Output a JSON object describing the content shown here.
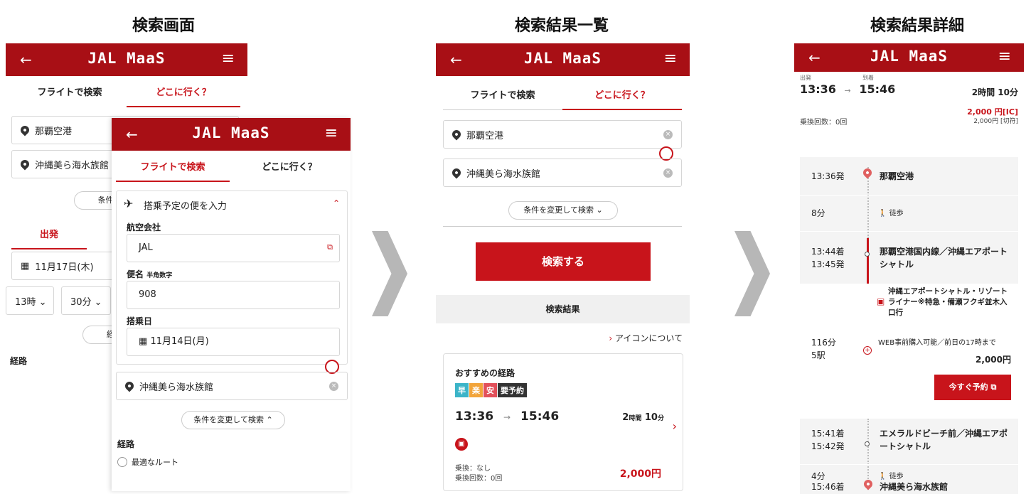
{
  "captions": [
    "検索画面",
    "検索結果一覧",
    "検索結果詳細"
  ],
  "header": {
    "back": "←",
    "logo": "JAL MaaS",
    "menu": "≡"
  },
  "screen1": {
    "tab_flight": "フライトで検索",
    "tab_where": "どこに行く？",
    "from": "那覇空港",
    "to": "沖縄美ら海水族館",
    "cond_btn": "条件を",
    "depart_tab": "出発",
    "date": "11月17日(木)",
    "hour": "13時 ⌄",
    "minute": "30分 ⌄",
    "route_btn": "経路",
    "route_label": "経路"
  },
  "screen1b": {
    "tab_flight": "フライトで検索",
    "tab_where": "どこに行く？",
    "flight_input": "搭乗予定の便を入力",
    "airline_label": "航空会社",
    "airline": "JAL",
    "flight_no_label": "便名",
    "flight_no_hint": "半角数字",
    "flight_no": "908",
    "board_label": "搭乗日",
    "board_date": "11月14日(月)",
    "dest": "沖縄美ら海水族館",
    "cond_btn": "条件を変更して検索 ⌃",
    "route_label": "経路",
    "route_opt": "最適なルート"
  },
  "screen2": {
    "tab_flight": "フライトで検索",
    "tab_where": "どこに行く？",
    "from": "那覇空港",
    "to": "沖縄美ら海水族館",
    "cond_btn": "条件を変更して検索 ⌄",
    "search_btn": "検索する",
    "results_hdr": "検索結果",
    "icon_about": "アイコンについて",
    "rec_title": "おすすめの経路",
    "tags": [
      "早",
      "楽",
      "安",
      "要予約"
    ],
    "dep": "13:36",
    "arr": "15:46",
    "dur_h": "2",
    "dur_h_unit": "時間",
    "dur_m": "10",
    "dur_m_unit": "分",
    "transfer": "乗換：なし",
    "transfer_count": "乗換回数：0回",
    "price": "2,000円"
  },
  "screen3": {
    "dep_label": "出発",
    "arr_label": "到着",
    "dep": "13:36",
    "arr": "15:46",
    "dur": "2時間 10分",
    "price_ic": "2,000 円[IC]",
    "price_ticket": "2,000円 [切符]",
    "transfers": "乗換回数：0回",
    "s1_time": "13:36発",
    "s1_name": "那覇空港",
    "walk1": "8分",
    "walk_label": "徒歩",
    "s2_arr": "13:44着",
    "s2_dep": "13:45発",
    "s2_name": "那覇空港国内線／沖縄エアポートシャトル",
    "bus_name": "沖縄エアポートシャトル・リゾートライナー※特急・備瀬フクギ並木入口行",
    "ride_time": "116分",
    "ride_stops": "5駅",
    "web_note": "WEB事前購入可能／前日の17時まで",
    "ride_price": "2,000円",
    "book_btn": "今すぐ予約",
    "s3_arr": "15:41着",
    "s3_dep": "15:42発",
    "s3_name": "エメラルドビーチ前／沖縄エアポートシャトル",
    "walk2": "4分",
    "s4_time": "15:46着",
    "s4_name": "沖縄美ら海水族館"
  }
}
